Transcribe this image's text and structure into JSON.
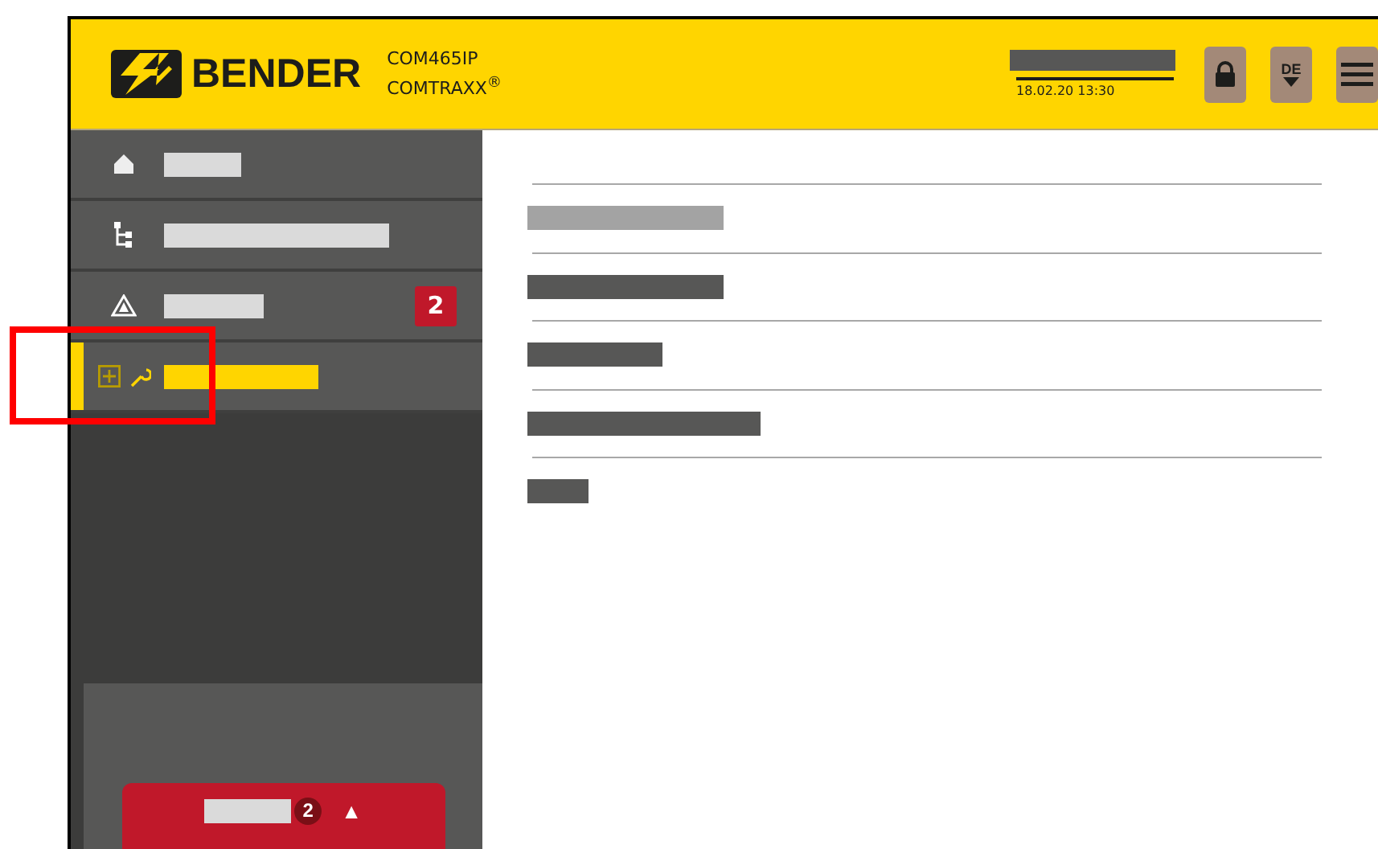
{
  "header": {
    "brand": "BENDER",
    "device_model": "COM465IP",
    "product_line": "COMTRAXX$^{®}$",
    "datetime": "18.02.20 13:30",
    "language": "DE"
  },
  "sidebar": {
    "items": [
      {
        "kind": "home",
        "selected": false
      },
      {
        "kind": "tree",
        "selected": false
      },
      {
        "kind": "alarm",
        "selected": false,
        "badge": "2"
      },
      {
        "kind": "tools",
        "selected": true
      }
    ]
  },
  "alarm_button": {
    "count": "2",
    "arrow": "▲"
  },
  "content": {
    "rows": [
      {
        "disabled": true
      },
      {
        "disabled": false
      },
      {
        "disabled": false
      },
      {
        "disabled": false
      },
      {
        "disabled": false
      }
    ]
  }
}
